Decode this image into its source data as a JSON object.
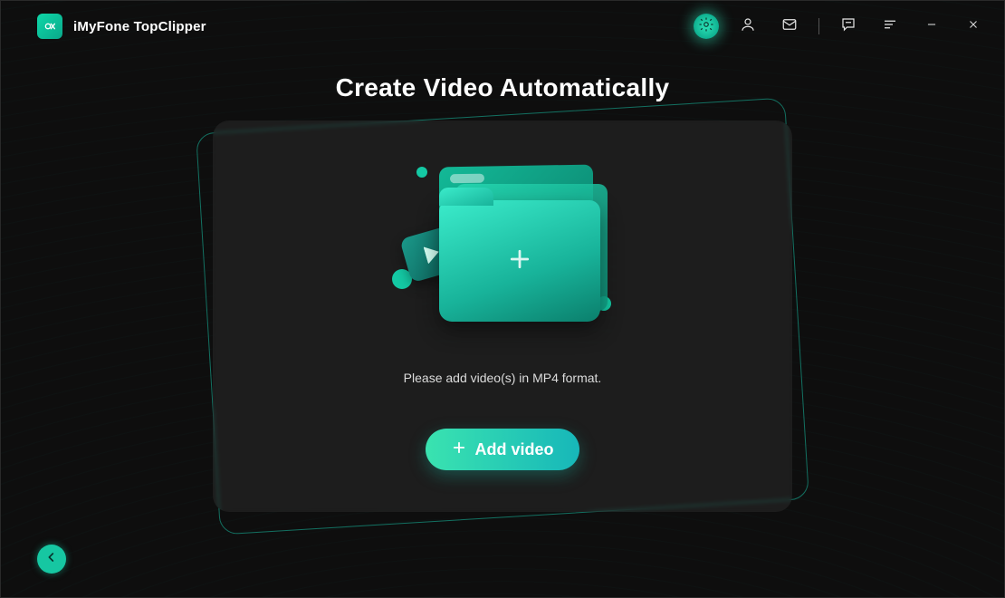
{
  "app": {
    "title": "iMyFone TopClipper"
  },
  "page": {
    "heading": "Create Video Automatically",
    "hint": "Please add video(s) in MP4 format.",
    "addButtonLabel": "Add video"
  },
  "icons": {
    "settings": "gear-icon",
    "account": "user-icon",
    "mail": "mail-icon",
    "feedback": "chat-icon",
    "menu": "menu-icon",
    "minimize": "minimize-icon",
    "close": "close-icon",
    "back": "arrow-left-icon",
    "plus": "plus-icon"
  },
  "colors": {
    "accent": "#1cc9a5",
    "background": "#0e0e0e",
    "cardOverlay": "rgba(70,70,70,0.28)"
  }
}
